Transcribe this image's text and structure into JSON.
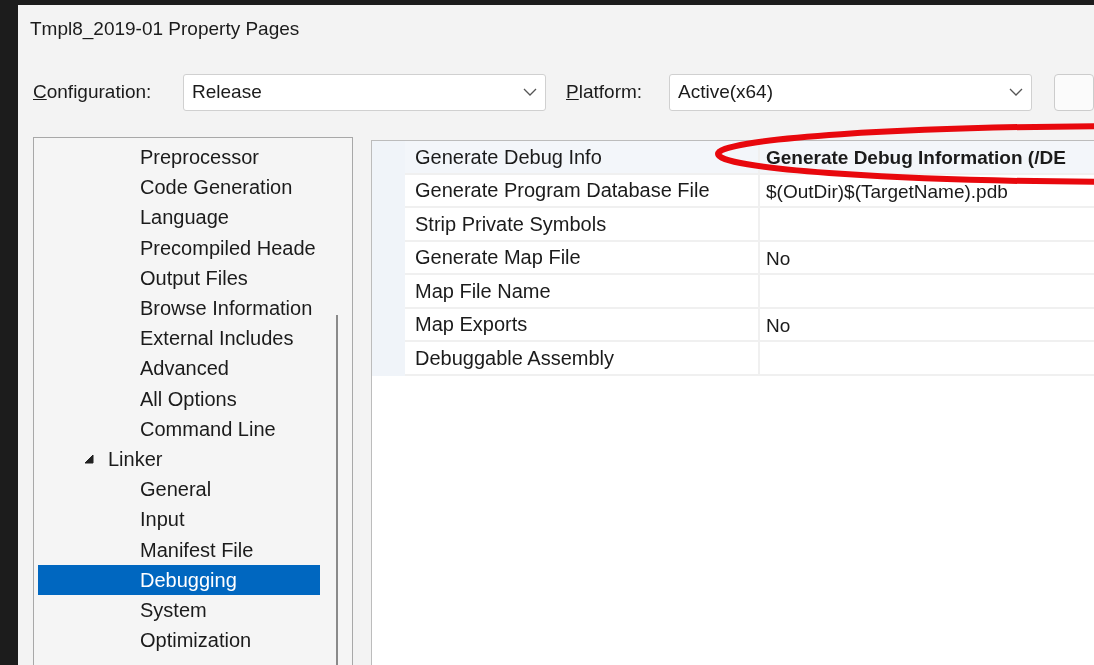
{
  "window": {
    "title": "Tmpl8_2019-01 Property Pages"
  },
  "configuration": {
    "label": "Configuration:",
    "value": "Release"
  },
  "platform": {
    "label": "Platform:",
    "value": "Active(x64)"
  },
  "tree": {
    "items": [
      {
        "label": "Preprocessor",
        "selected": false
      },
      {
        "label": "Code Generation",
        "selected": false
      },
      {
        "label": "Language",
        "selected": false
      },
      {
        "label": "Precompiled Heade",
        "selected": false
      },
      {
        "label": "Output Files",
        "selected": false
      },
      {
        "label": "Browse Information",
        "selected": false
      },
      {
        "label": "External Includes",
        "selected": false
      },
      {
        "label": "Advanced",
        "selected": false
      },
      {
        "label": "All Options",
        "selected": false
      },
      {
        "label": "Command Line",
        "selected": false
      },
      {
        "label": "Linker",
        "selected": false,
        "expanded": true,
        "children": [
          {
            "label": "General",
            "selected": false
          },
          {
            "label": "Input",
            "selected": false
          },
          {
            "label": "Manifest File",
            "selected": false
          },
          {
            "label": "Debugging",
            "selected": true
          },
          {
            "label": "System",
            "selected": false
          },
          {
            "label": "Optimization",
            "selected": false
          }
        ]
      }
    ]
  },
  "properties": [
    {
      "name": "Generate Debug Info",
      "value": "Generate Debug Information (/DE",
      "modified": true,
      "selected": true
    },
    {
      "name": "Generate Program Database File",
      "value": "$(OutDir)$(TargetName).pdb",
      "modified": false,
      "selected": false
    },
    {
      "name": "Strip Private Symbols",
      "modified": false,
      "selected": false
    },
    {
      "name": "Generate Map File",
      "value": "No",
      "modified": false,
      "selected": false
    },
    {
      "name": "Map File Name",
      "modified": false,
      "selected": false
    },
    {
      "name": "Map Exports",
      "value": "No",
      "modified": false,
      "selected": false
    },
    {
      "name": "Debuggable Assembly",
      "modified": false,
      "selected": false
    }
  ]
}
